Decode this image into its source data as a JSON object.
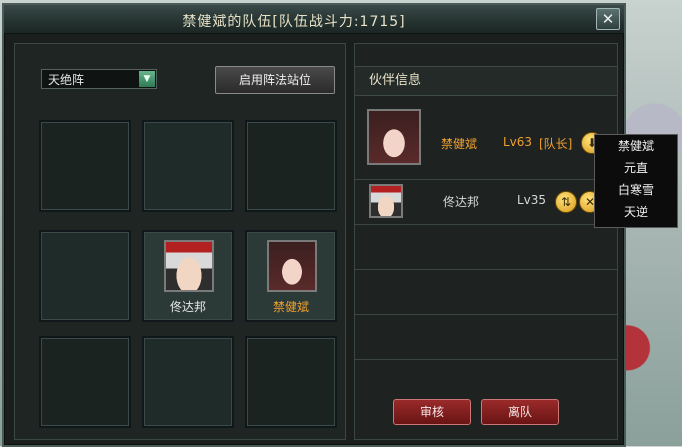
{
  "window": {
    "title": "禁健斌的队伍[队伍战斗力:1715]",
    "close_label": "✕"
  },
  "formation": {
    "selected": "天绝阵",
    "enable_button": "启用阵法站位"
  },
  "grid": {
    "cells": [
      {
        "name": ""
      },
      {
        "name": ""
      },
      {
        "name": ""
      },
      {
        "name": ""
      },
      {
        "name": "佟达邦",
        "portrait": "male-red-headband",
        "color": "#e8e8e8"
      },
      {
        "name": "禁健斌",
        "portrait": "female-dark-hair",
        "color": "#f0a030"
      },
      {
        "name": ""
      },
      {
        "name": ""
      },
      {
        "name": ""
      }
    ]
  },
  "partners": {
    "header": "伙伴信息",
    "rows": [
      {
        "name": "禁健斌",
        "level": "Lv63",
        "role": "[队长]",
        "name_color": "#f0a030",
        "level_color": "#f0a030",
        "icon": "arrow-down-icon"
      },
      {
        "name": "佟达邦",
        "level": "Lv35",
        "role": "",
        "name_color": "#d8d8d8",
        "level_color": "#d8d8d8",
        "icon": "swap-icon"
      }
    ]
  },
  "menu": {
    "items": [
      "禁健斌",
      "元直",
      "白寒雪",
      "天逆"
    ]
  },
  "actions": {
    "review": "审核",
    "leave": "离队"
  }
}
